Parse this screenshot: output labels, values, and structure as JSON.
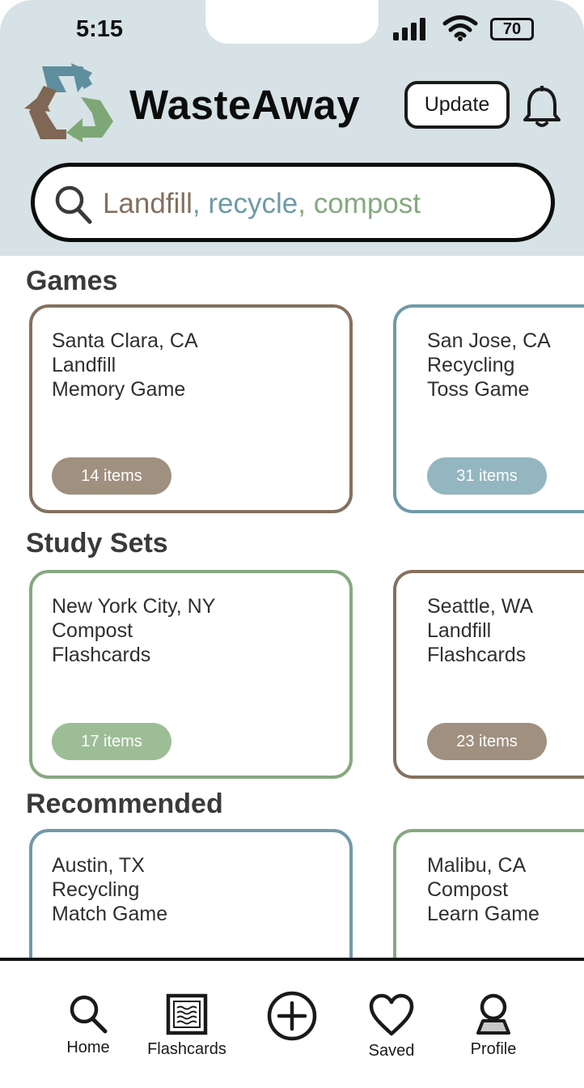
{
  "status_bar": {
    "time": "5:15",
    "battery": "70"
  },
  "app": {
    "name": "WasteAway",
    "update_label": "Update"
  },
  "search": {
    "word1": "Landfill",
    "comma1": ", ",
    "word2": "recycle",
    "comma2": ", ",
    "word3": "compost"
  },
  "colors": {
    "landfill": "#84705f",
    "recycle": "#6f9aa8",
    "compost": "#85a97f"
  },
  "sections": [
    {
      "title": "Games",
      "cards": [
        {
          "line1": "Santa Clara, CA",
          "line2": "Landfill",
          "line3": "Memory Game",
          "count": "14 items"
        },
        {
          "line1": "San Jose, CA",
          "line2": "Recycling",
          "line3": "Toss Game",
          "count": "31 items"
        }
      ]
    },
    {
      "title": "Study Sets",
      "cards": [
        {
          "line1": "New York City, NY",
          "line2": "Compost",
          "line3": "Flashcards",
          "count": "17 items"
        },
        {
          "line1": "Seattle, WA",
          "line2": "Landfill",
          "line3": "Flashcards",
          "count": "23 items"
        }
      ]
    },
    {
      "title": "Recommended",
      "cards": [
        {
          "line1": "Austin, TX",
          "line2": "Recycling",
          "line3": "Match Game"
        },
        {
          "line1": "Malibu, CA",
          "line2": "Compost",
          "line3": "Learn Game"
        }
      ]
    }
  ],
  "nav": [
    {
      "label": "Home",
      "icon": "search-icon"
    },
    {
      "label": "Flashcards",
      "icon": "flashcards-icon"
    },
    {
      "label": "",
      "icon": "add-circle-icon"
    },
    {
      "label": "Saved",
      "icon": "heart-icon"
    },
    {
      "label": "Profile",
      "icon": "profile-icon"
    }
  ]
}
